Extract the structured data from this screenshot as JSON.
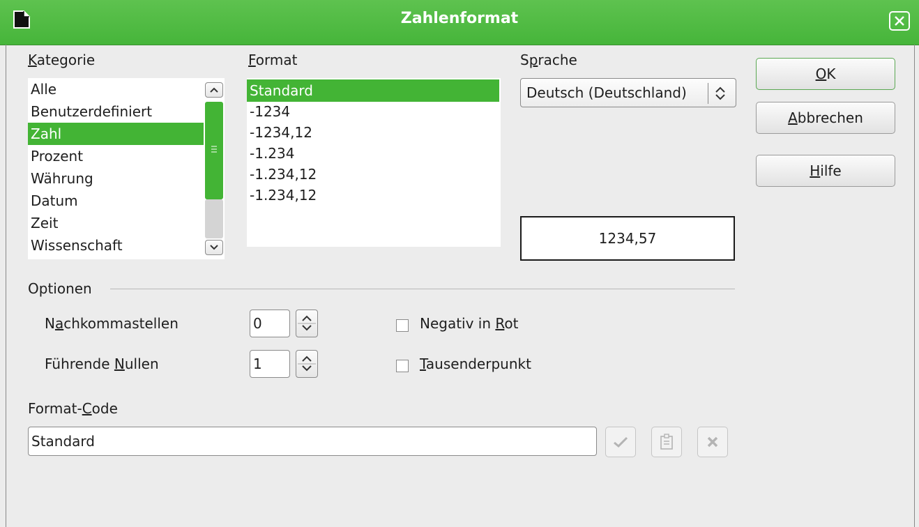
{
  "window": {
    "title": "Zahlenformat"
  },
  "category": {
    "label": "Kategorie",
    "items": [
      "Alle",
      "Benutzerdefiniert",
      "Zahl",
      "Prozent",
      "Währung",
      "Datum",
      "Zeit",
      "Wissenschaft"
    ],
    "selected": "Zahl"
  },
  "format": {
    "label": "Format",
    "items": [
      "Standard",
      "-1234",
      "-1234,12",
      "-1.234",
      "-1.234,12",
      "-1.234,12"
    ],
    "selected": "Standard"
  },
  "language": {
    "label": "Sprache",
    "value": "Deutsch (Deutschland)"
  },
  "preview": {
    "value": "1234,57"
  },
  "buttons": {
    "ok": "OK",
    "cancel": "Abbrechen",
    "help": "Hilfe"
  },
  "options": {
    "label": "Optionen",
    "decimals_label": "Nachkommastellen",
    "decimals_value": "0",
    "leading_zeros_label": "Führende Nullen",
    "leading_zeros_value": "1",
    "negative_red_label": "Negativ in Rot",
    "thousands_sep_label": "Tausenderpunkt"
  },
  "format_code": {
    "label": "Format-Code",
    "value": "Standard"
  },
  "colors": {
    "titlebar": "#46b53a",
    "selection": "#43b435"
  }
}
